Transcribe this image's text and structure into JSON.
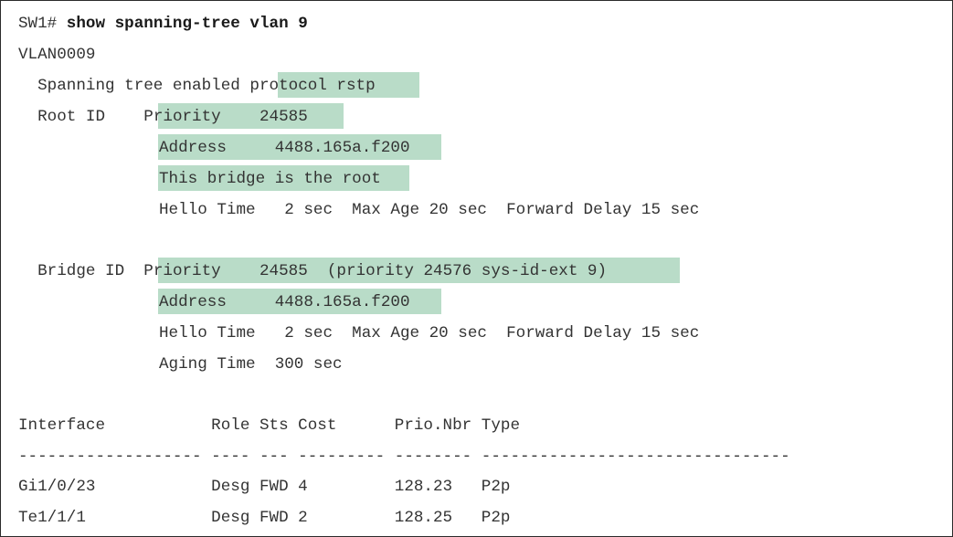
{
  "terminal": {
    "prompt": "SW1# ",
    "command": "show spanning-tree vlan 9",
    "vlan": "VLAN0009",
    "stp_enabled": "  Spanning tree enabled ",
    "protocol": "protocol rstp",
    "root_id": {
      "label": "  Root ID    ",
      "priority": "Priority    24585",
      "address": "Address     4488.165a.f200",
      "this_bridge": "This bridge is the root",
      "hello": "Hello Time   2 sec  Max Age 20 sec  Forward Delay 15 sec"
    },
    "bridge_id": {
      "label": "  Bridge ID  ",
      "priority": "Priority    24585  (priority 24576 sys-id-ext 9)",
      "address": "Address     4488.165a.f200",
      "hello": "Hello Time   2 sec  Max Age 20 sec  Forward Delay 15 sec",
      "aging": "Aging Time  300 sec"
    },
    "table": {
      "header": "Interface           Role Sts Cost      Prio.Nbr Type",
      "separator": "------------------- ---- --- --------- -------- --------------------------------",
      "rows": [
        "Gi1/0/23            Desg FWD 4         128.23   P2p",
        "Te1/1/1             Desg FWD 2         128.25   P2p"
      ]
    }
  },
  "colors": {
    "highlight": "#b9dcc8",
    "text": "#333333",
    "border": "#2b2b2b"
  }
}
